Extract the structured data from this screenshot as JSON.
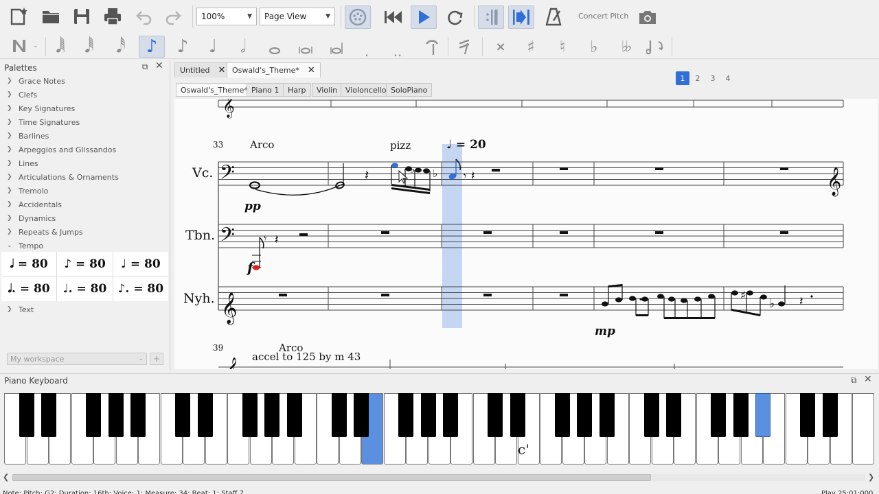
{
  "toolbar": {
    "zoom": "100%",
    "view_mode": "Page View",
    "concert_pitch": "Concert Pitch",
    "voices": [
      "1",
      "2",
      "3",
      "4"
    ]
  },
  "palettes": {
    "title": "Palettes",
    "items": [
      "Grace Notes",
      "Clefs",
      "Key Signatures",
      "Time Signatures",
      "Barlines",
      "Arpeggios and Glissandos",
      "Lines",
      "Articulations & Ornaments",
      "Tremolo",
      "Accidentals",
      "Dynamics",
      "Repeats & Jumps",
      "Tempo"
    ],
    "tempo_cells": [
      "𝅗𝅥 = 80",
      "♪ = 80",
      "♩ = 80",
      "𝅗𝅥. = 80",
      "♩. = 80",
      "♪. = 80"
    ],
    "after": "Text",
    "workspace": "My workspace"
  },
  "tabs": [
    {
      "label": "Untitled"
    },
    {
      "label": "Oswald's_Theme*"
    }
  ],
  "subtabs": [
    "Oswald's_Theme*",
    "Piano 1",
    "Harp",
    "Violin",
    "Violoncello",
    "SoloPiano"
  ],
  "score": {
    "measure_num_1": "33",
    "measure_num_2": "39",
    "arco": "Arco",
    "pizz": "pizz",
    "tempo_mark": "♩ = 20",
    "dyn_pp": "pp",
    "dyn_f": "f",
    "dyn_mp": "mp",
    "arco2": "Arco",
    "accel": "accel to 125 by m 43",
    "instruments": [
      "Vc.",
      "Tbn.",
      "Nyh."
    ]
  },
  "keyboard": {
    "title": "Piano Keyboard",
    "c_label": "c'"
  },
  "status": {
    "left": "Note; Pitch: G2; Duration: 16th; Voice: 1; Measure: 34; Beat: 1; Staff 7",
    "right": "Play   25:01:000"
  },
  "colors": {
    "accent": "#2f6fd6",
    "key_highlight": "#5b8fe0",
    "selection": "#c5d6f2"
  }
}
